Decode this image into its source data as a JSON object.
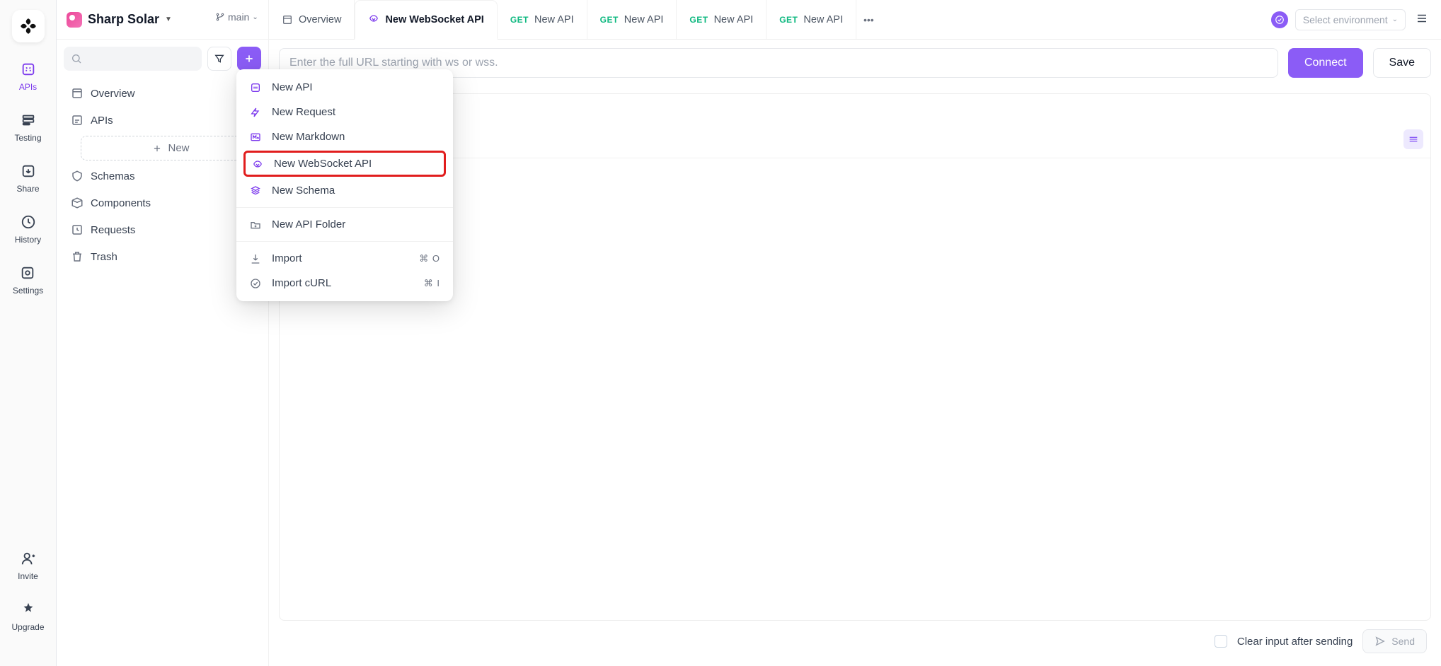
{
  "rail": {
    "apis": "APIs",
    "testing": "Testing",
    "share": "Share",
    "history": "History",
    "settings": "Settings",
    "invite": "Invite",
    "upgrade": "Upgrade"
  },
  "project": {
    "name": "Sharp Solar",
    "branch": "main"
  },
  "tree": {
    "overview": "Overview",
    "apis": "APIs",
    "new": "New",
    "schemas": "Schemas",
    "components": "Components",
    "requests": "Requests",
    "trash": "Trash"
  },
  "tabs": {
    "overview": "Overview",
    "active": "New WebSocket API",
    "get1": "New API",
    "get2": "New API",
    "get3": "New API",
    "get4": "New API",
    "method": "GET"
  },
  "env": {
    "placeholder": "Select environment"
  },
  "url": {
    "placeholder": "Enter the full URL starting with ws or wss.",
    "connect": "Connect",
    "save": "Save"
  },
  "footer": {
    "clear": "Clear input after sending",
    "send": "Send"
  },
  "menu": {
    "new_api": "New API",
    "new_request": "New Request",
    "new_markdown": "New Markdown",
    "new_ws": "New WebSocket API",
    "new_schema": "New Schema",
    "new_folder": "New API Folder",
    "import": "Import",
    "import_curl": "Import cURL",
    "sc_import": "⌘ O",
    "sc_curl": "⌘ I"
  }
}
